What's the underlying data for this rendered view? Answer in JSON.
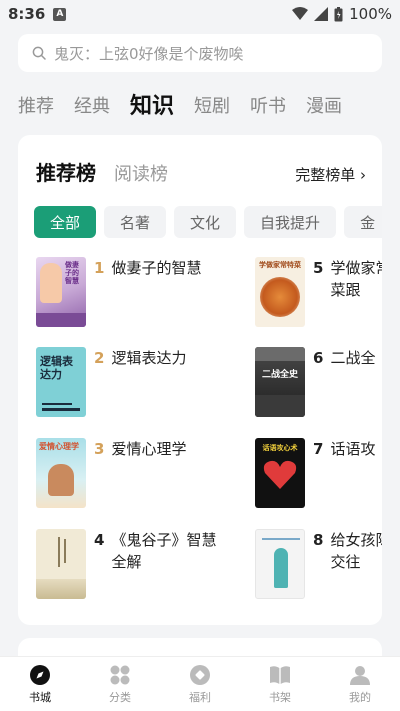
{
  "status": {
    "time": "8:36",
    "badge": "A",
    "battery": "100%"
  },
  "search": {
    "placeholder": "鬼灭：上弦0好像是个废物唉"
  },
  "category_tabs": [
    {
      "label": "推荐"
    },
    {
      "label": "经典"
    },
    {
      "label": "知识"
    },
    {
      "label": "短剧"
    },
    {
      "label": "听书"
    },
    {
      "label": "漫画"
    }
  ],
  "ranking": {
    "tabs": [
      {
        "label": "推荐榜"
      },
      {
        "label": "阅读榜"
      }
    ],
    "full_label": "完整榜单 ›",
    "filters": [
      {
        "label": "全部"
      },
      {
        "label": "名著"
      },
      {
        "label": "文化"
      },
      {
        "label": "自我提升"
      },
      {
        "label": "金"
      }
    ],
    "books": [
      {
        "rank": "1",
        "title": "做妻子的智慧",
        "cover_text": "做妻子的智慧"
      },
      {
        "rank": "2",
        "title": "逻辑表达力",
        "cover_text": "逻辑表达力"
      },
      {
        "rank": "3",
        "title": "爱情心理学",
        "cover_text": "爱情心理学"
      },
      {
        "rank": "4",
        "title": "《鬼谷子》智慧全解",
        "cover_text": ""
      },
      {
        "rank": "5",
        "title": "学做家常菜跟",
        "cover_text": "学做家常特菜"
      },
      {
        "rank": "6",
        "title": "二战全",
        "cover_text": "二战全史"
      },
      {
        "rank": "7",
        "title": "话语攻",
        "cover_text": "话语攻心术"
      },
      {
        "rank": "8",
        "title": "给女孩际交往",
        "cover_text": ""
      }
    ]
  },
  "bottom_nav": [
    {
      "label": "书城",
      "icon": "bookstore-icon"
    },
    {
      "label": "分类",
      "icon": "category-icon"
    },
    {
      "label": "福利",
      "icon": "welfare-icon"
    },
    {
      "label": "书架",
      "icon": "bookshelf-icon"
    },
    {
      "label": "我的",
      "icon": "profile-icon"
    }
  ],
  "colors": {
    "accent": "#1b9e77",
    "rank_gold": "#d4a15a"
  }
}
